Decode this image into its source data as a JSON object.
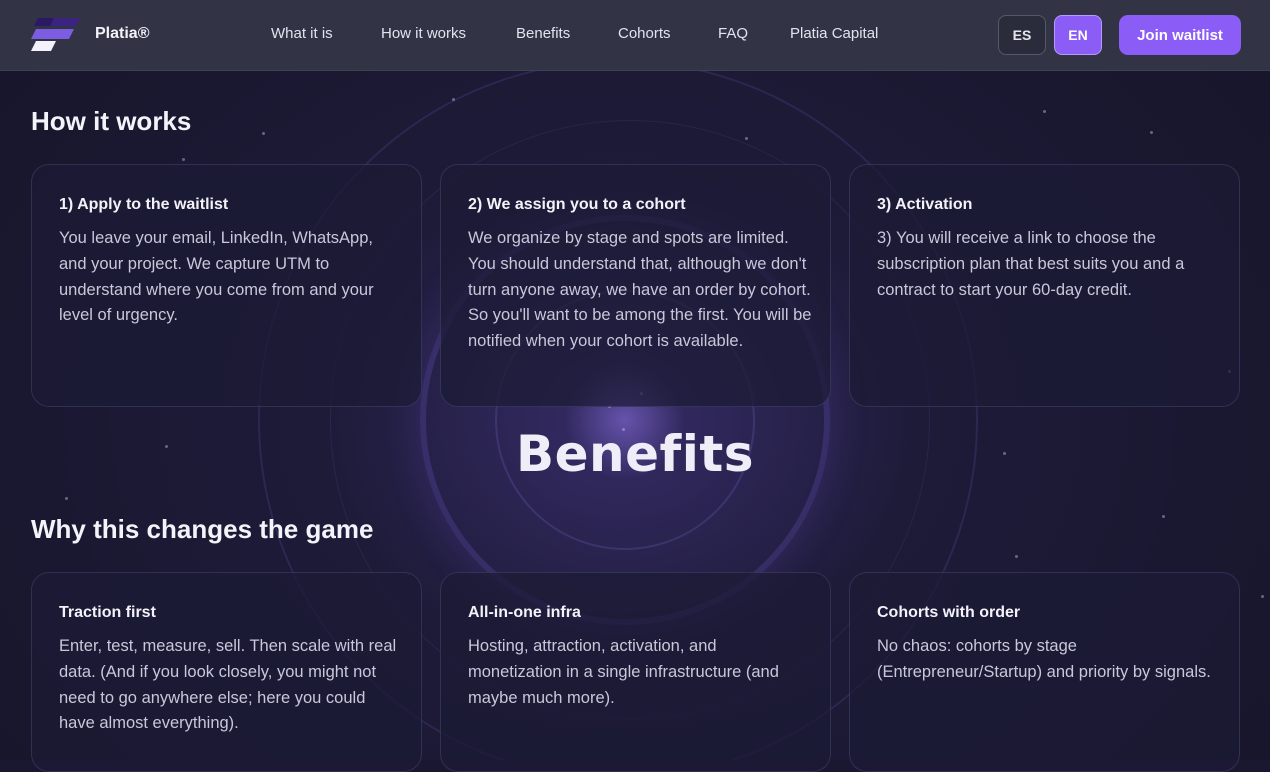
{
  "header": {
    "brand": "Platia®",
    "nav": [
      "What it is",
      "How it works",
      "Benefits",
      "Cohorts",
      "FAQ",
      "Platia Capital"
    ],
    "lang_es": "ES",
    "lang_en": "EN",
    "cta": "Join waitlist",
    "accent": "#8b5cf6"
  },
  "how": {
    "title": "How it works",
    "cards": [
      {
        "title": "1) Apply to the waitlist",
        "body": "You leave your email, LinkedIn, WhatsApp, and your project. We capture UTM to understand where you come from and your level of urgency."
      },
      {
        "title": "2) We assign you to a cohort",
        "body": "We organize by stage and spots are limited. You should understand that, although we don't turn anyone away, we have an order by cohort. So you'll want to be among the first. You will be notified when your cohort is available."
      },
      {
        "title": "3) Activation",
        "body": "3) You will receive a link to choose the subscription plan that best suits you and a contract to start your 60-day credit."
      }
    ]
  },
  "benefits": {
    "heading": "Benefits",
    "title": "Why this changes the game",
    "cards": [
      {
        "title": "Traction first",
        "body": "Enter, test, measure, sell. Then scale with real data. (And if you look closely, you might not need to go anywhere else; here you could have almost everything)."
      },
      {
        "title": "All-in-one infra",
        "body": "Hosting, attraction, activation, and monetization in a single infrastructure (and maybe much more)."
      },
      {
        "title": "Cohorts with order",
        "body": "No chaos: cohorts by stage (Entrepreneur/Startup) and priority by signals."
      }
    ]
  }
}
